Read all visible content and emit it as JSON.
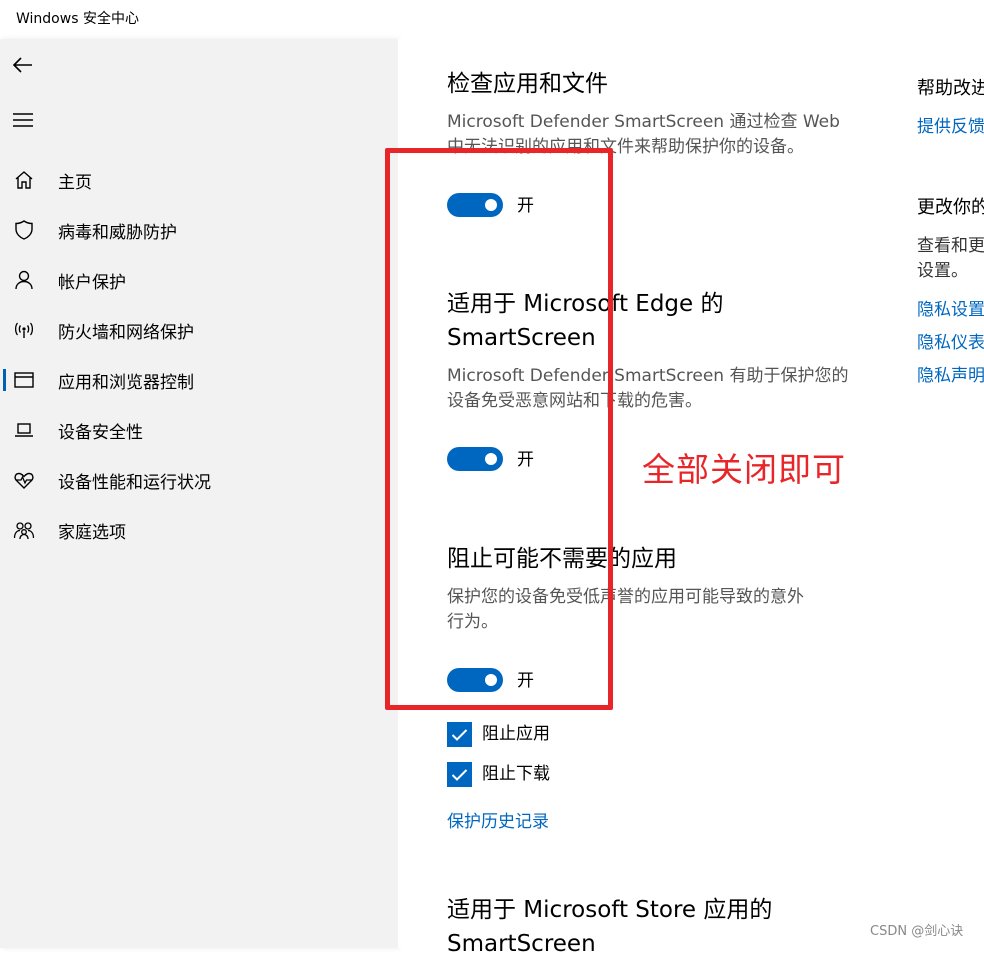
{
  "window": {
    "title": "Windows 安全中心"
  },
  "sidebar": {
    "items": [
      {
        "label": "主页",
        "icon": "home-icon"
      },
      {
        "label": "病毒和威胁防护",
        "icon": "shield-icon"
      },
      {
        "label": "帐户保护",
        "icon": "person-icon"
      },
      {
        "label": "防火墙和网络保护",
        "icon": "wifi-signal-icon"
      },
      {
        "label": "应用和浏览器控制",
        "icon": "browser-window-icon",
        "active": true
      },
      {
        "label": "设备安全性",
        "icon": "laptop-icon"
      },
      {
        "label": "设备性能和运行状况",
        "icon": "heart-pulse-icon"
      },
      {
        "label": "家庭选项",
        "icon": "family-icon"
      }
    ]
  },
  "main": {
    "section1": {
      "title": "检查应用和文件",
      "desc_line1": "Microsoft Defender SmartScreen 通过检查 Web",
      "desc_line2": "中无法识别的应用和文件来帮助保护你的设备。",
      "toggle_label": "开"
    },
    "section2": {
      "title_line1": "适用于 Microsoft Edge 的",
      "title_line2": "SmartScreen",
      "desc_line1": "Microsoft Defender SmartScreen 有助于保护您的",
      "desc_line2": "设备免受恶意网站和下载的危害。",
      "toggle_label": "开"
    },
    "section3": {
      "title": "阻止可能不需要的应用",
      "desc_line1": "保护您的设备免受低声誉的应用可能导致的意外",
      "desc_line2": "行为。",
      "toggle_label": "开",
      "checkbox1_label": "阻止应用",
      "checkbox2_label": "阻止下载",
      "history_link": "保护历史记录"
    },
    "section4": {
      "title_line1": "适用于 Microsoft Store 应用的",
      "title_line2": "SmartScreen"
    }
  },
  "right_panel": {
    "help_heading": "帮助改进",
    "feedback_link": "提供反馈",
    "change_heading": "更改你的",
    "view_line1": "查看和更",
    "view_line2": "设置。",
    "privacy_settings_link": "隐私设置",
    "privacy_dashboard_link": "隐私仪表",
    "privacy_statement_link": "隐私声明"
  },
  "annotation": {
    "text": "全部关闭即可"
  },
  "watermark": {
    "text": "CSDN @剑心诀"
  },
  "colors": {
    "accent": "#0067c0",
    "annotation_red": "#e8262a",
    "sidebar_bg": "#f2f2f2"
  }
}
